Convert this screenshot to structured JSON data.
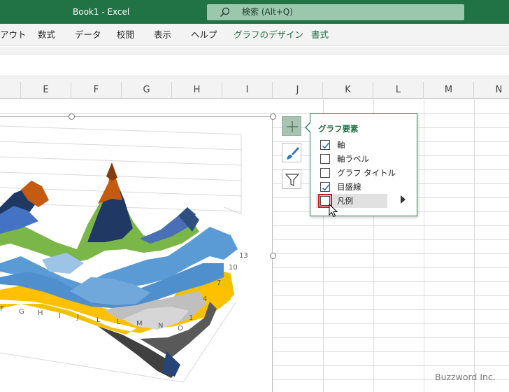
{
  "titlebar": {
    "window_title": "Book1  -  Excel",
    "search_placeholder": "検索 (Alt+Q)"
  },
  "ribbon_tabs": [
    "アウト",
    "数式",
    "データ",
    "校閲",
    "表示",
    "ヘルプ",
    "グラフのデザイン",
    "書式"
  ],
  "columns": [
    "E",
    "F",
    "G",
    "H",
    "I",
    "J",
    "K",
    "L",
    "M",
    "N"
  ],
  "chart_data": {
    "type": "surface",
    "x_tick_labels": [
      "F",
      "G",
      "H",
      "I",
      "J",
      "L",
      "L",
      "M",
      "N",
      "O"
    ],
    "depth_tick_labels": [
      "1",
      "4",
      "7",
      "10",
      "13"
    ],
    "band_colors": [
      "#2e4f7f",
      "#4f8fce",
      "#7ab648",
      "#1f3864",
      "#4a6fb5",
      "#c55a11",
      "#ffc000",
      "#bfbfbf",
      "#404040",
      "#264478"
    ]
  },
  "chart_elements_flyout": {
    "title": "グラフ要素",
    "items": [
      {
        "label": "軸",
        "checked": true
      },
      {
        "label": "軸ラベル",
        "checked": false
      },
      {
        "label": "グラフ タイトル",
        "checked": false
      },
      {
        "label": "目盛線",
        "checked": true
      },
      {
        "label": "凡例",
        "checked": false
      }
    ]
  },
  "side_buttons": [
    "chart-elements",
    "chart-styles",
    "chart-filters"
  ],
  "watermark": "Buzzword Inc."
}
